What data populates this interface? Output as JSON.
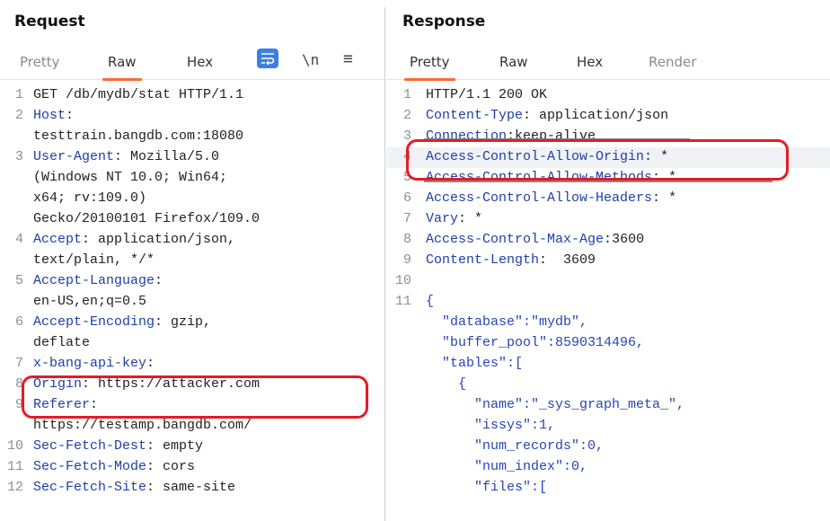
{
  "request": {
    "title": "Request",
    "tabs": [
      "Pretty",
      "Raw",
      "Hex"
    ],
    "active_tab": "Raw",
    "newline_btn": "\\n",
    "menu_btn": "≡",
    "lines": [
      {
        "num": "1",
        "key": "",
        "sep": "",
        "val": "GET /db/mydb/stat HTTP/1.1"
      },
      {
        "num": "2",
        "key": "Host",
        "sep": ":",
        "val": ""
      },
      {
        "num": "",
        "key": "",
        "sep": "",
        "val": "testtrain.bangdb.com:18080"
      },
      {
        "num": "3",
        "key": "User-Agent",
        "sep": ":",
        "val": " Mozilla/5.0"
      },
      {
        "num": "",
        "key": "",
        "sep": "",
        "val": "(Windows NT 10.0; Win64;"
      },
      {
        "num": "",
        "key": "",
        "sep": "",
        "val": "x64; rv:109.0)"
      },
      {
        "num": "",
        "key": "",
        "sep": "",
        "val": "Gecko/20100101 Firefox/109.0"
      },
      {
        "num": "4",
        "key": "Accept",
        "sep": ":",
        "val": " application/json,"
      },
      {
        "num": "",
        "key": "",
        "sep": "",
        "val": "text/plain, */*"
      },
      {
        "num": "5",
        "key": "Accept-Language",
        "sep": ":",
        "val": ""
      },
      {
        "num": "",
        "key": "",
        "sep": "",
        "val": "en-US,en;q=0.5"
      },
      {
        "num": "6",
        "key": "Accept-Encoding",
        "sep": ":",
        "val": " gzip,"
      },
      {
        "num": "",
        "key": "",
        "sep": "",
        "val": "deflate"
      },
      {
        "num": "7",
        "key": "x-bang-api-key",
        "sep": ":",
        "val": ""
      },
      {
        "num": "8",
        "key": "Origin",
        "sep": ":",
        "val": " https://attacker.com"
      },
      {
        "num": "9",
        "key": "Referer",
        "sep": ":",
        "val": ""
      },
      {
        "num": "",
        "key": "",
        "sep": "",
        "val": "https://testamp.bangdb.com/"
      },
      {
        "num": "10",
        "key": "Sec-Fetch-Dest",
        "sep": ":",
        "val": " empty"
      },
      {
        "num": "11",
        "key": "Sec-Fetch-Mode",
        "sep": ":",
        "val": " cors"
      },
      {
        "num": "12",
        "key": "Sec-Fetch-Site",
        "sep": ":",
        "val": " same-site"
      }
    ]
  },
  "response": {
    "title": "Response",
    "tabs": [
      "Pretty",
      "Raw",
      "Hex",
      "Render"
    ],
    "active_tab": "Pretty",
    "lines": [
      {
        "num": "1",
        "key": "",
        "sep": "",
        "val": "HTTP/1.1 200 OK"
      },
      {
        "num": "2",
        "key": "Content-Type",
        "sep": ":",
        "val": " application/json"
      },
      {
        "num": "3",
        "key": "Connection",
        "sep": ":",
        "val": "keep-alive"
      },
      {
        "num": "4",
        "key": "Access-Control-Allow-Origin",
        "sep": ":",
        "val": " *"
      },
      {
        "num": "5",
        "key": "Access-Control-Allow-Methods",
        "sep": ":",
        "val": " *"
      },
      {
        "num": "6",
        "key": "Access-Control-Allow-Headers",
        "sep": ":",
        "val": " *"
      },
      {
        "num": "7",
        "key": "Vary",
        "sep": ":",
        "val": " *"
      },
      {
        "num": "8",
        "key": "Access-Control-Max-Age",
        "sep": ":",
        "val": "3600"
      },
      {
        "num": "9",
        "key": "Content-Length",
        "sep": ":",
        "val": "  3609"
      },
      {
        "num": "10",
        "key": "",
        "sep": "",
        "val": ""
      },
      {
        "num": "11",
        "key": "",
        "sep": "",
        "val": "{"
      },
      {
        "num": "",
        "key": "",
        "sep": "",
        "val": "  \"database\":\"mydb\","
      },
      {
        "num": "",
        "key": "",
        "sep": "",
        "val": "  \"buffer_pool\":8590314496,"
      },
      {
        "num": "",
        "key": "",
        "sep": "",
        "val": "  \"tables\":["
      },
      {
        "num": "",
        "key": "",
        "sep": "",
        "val": "    {"
      },
      {
        "num": "",
        "key": "",
        "sep": "",
        "val": "      \"name\":\"_sys_graph_meta_\","
      },
      {
        "num": "",
        "key": "",
        "sep": "",
        "val": "      \"issys\":1,"
      },
      {
        "num": "",
        "key": "",
        "sep": "",
        "val": "      \"num_records\":0,"
      },
      {
        "num": "",
        "key": "",
        "sep": "",
        "val": "      \"num_index\":0,"
      },
      {
        "num": "",
        "key": "",
        "sep": "",
        "val": "      \"files\":["
      }
    ]
  },
  "colors": {
    "accent_tab": "#ff6a35",
    "header_key": "#1f3fa8",
    "annotation": "#e41c25",
    "wrap_button": "#3d7ee6"
  },
  "icons": {
    "wrap": "wrap-lines-icon",
    "newline": "newline-icon",
    "menu": "hamburger-menu-icon"
  }
}
